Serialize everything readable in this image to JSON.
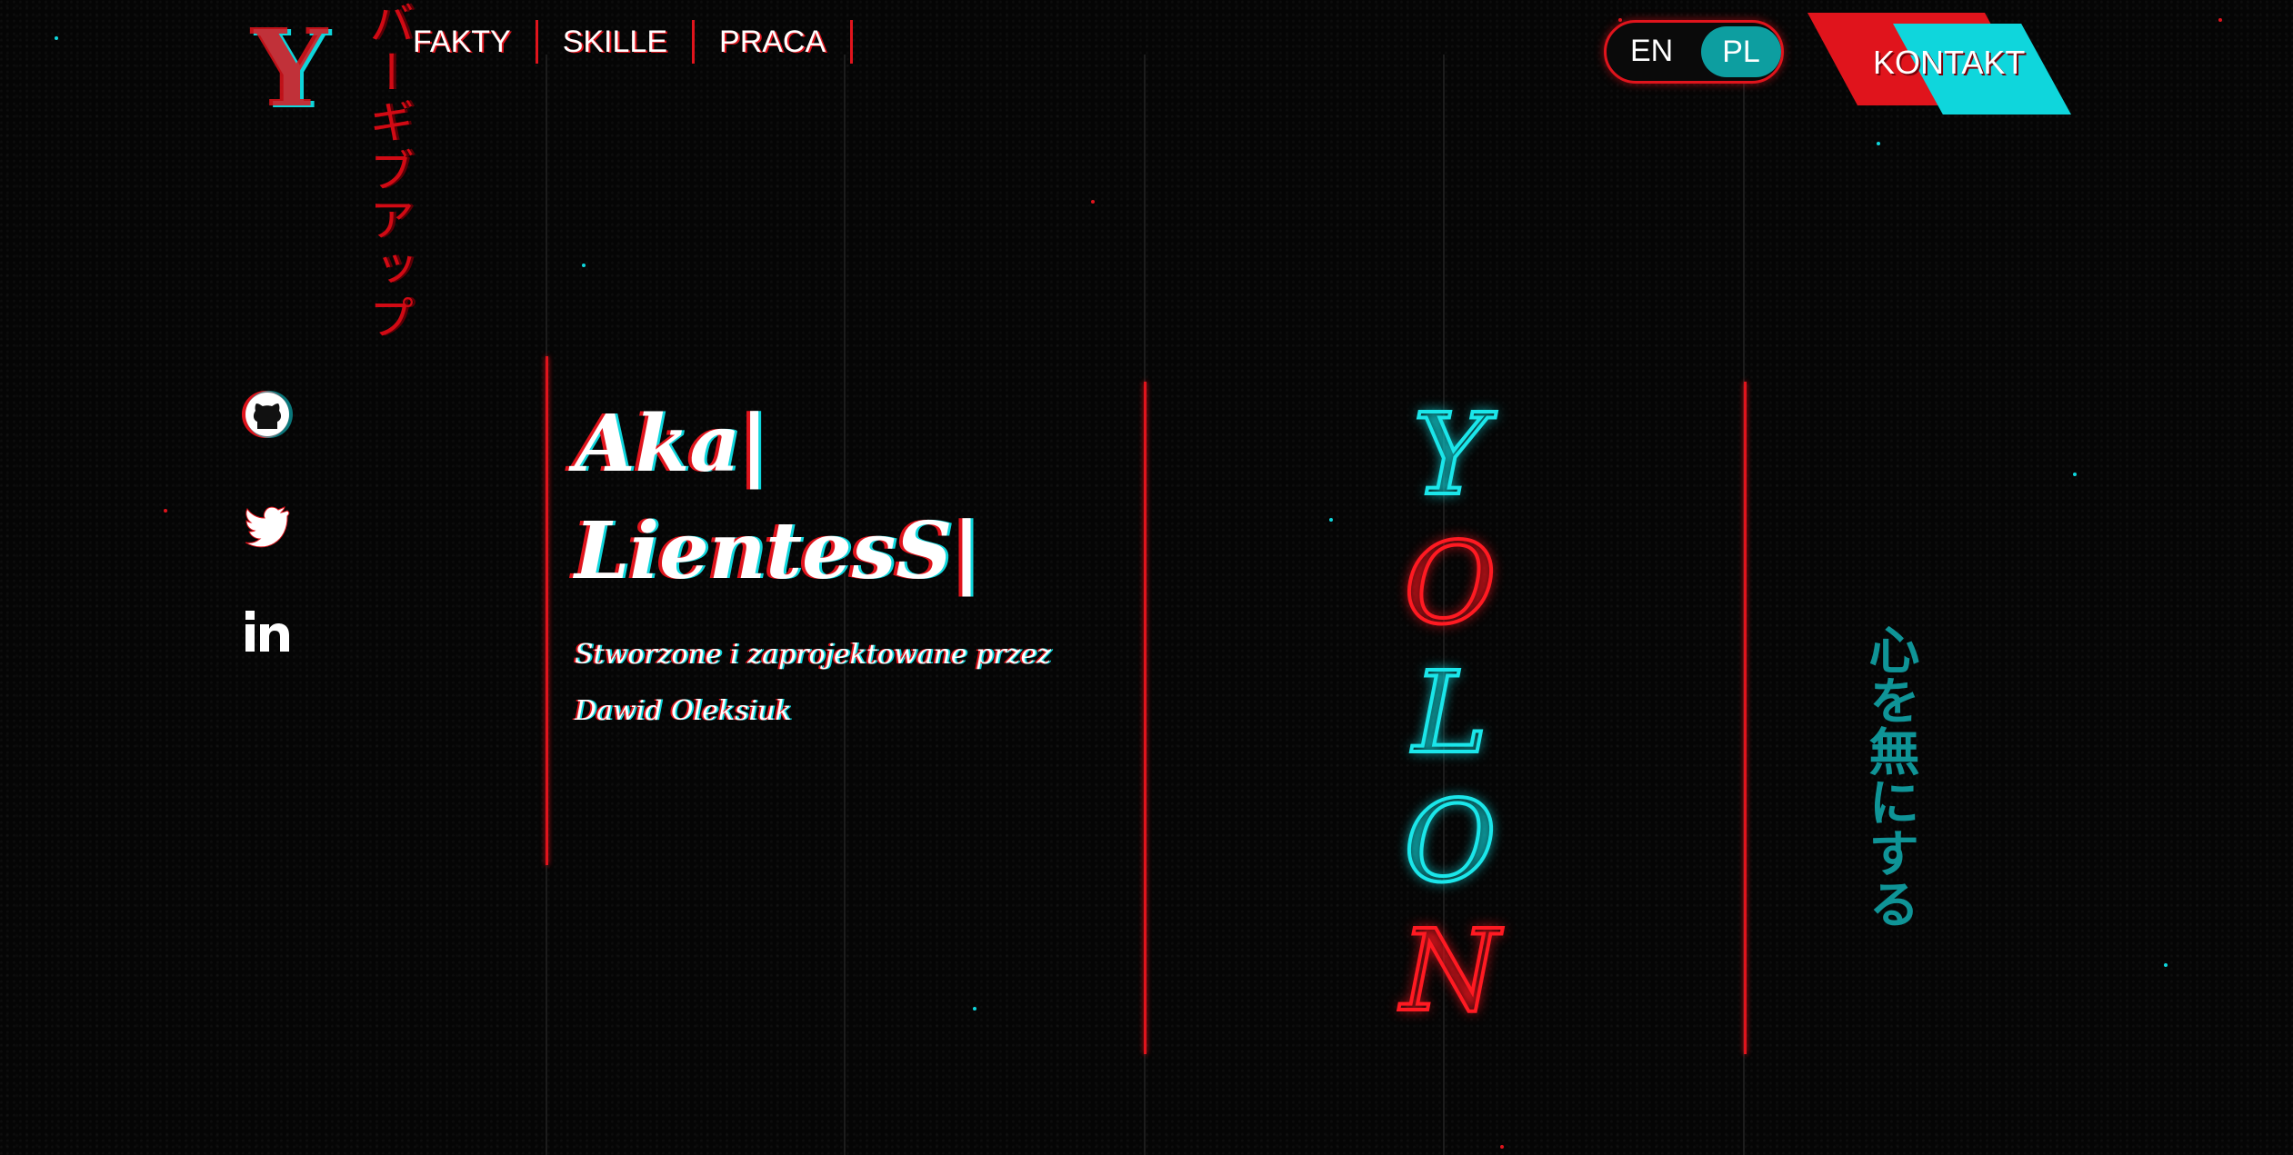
{
  "header": {
    "kana_vertical": "バーギブアップ",
    "nav": [
      "FAKTY",
      "SKILLE",
      "PRACA"
    ],
    "lang": {
      "en": "EN",
      "pl": "PL",
      "active": "PL"
    },
    "contact_label": "KONTAKT"
  },
  "logo": {
    "letter": "Y"
  },
  "socials": [
    "github-icon",
    "twitter-icon",
    "linkedin-icon"
  ],
  "hero": {
    "title_line1": "Aka|",
    "title_line2": "LientesS|",
    "subtitle": "Stworzone i zaprojektowane przez Dawid Oleksiuk"
  },
  "neon_word": [
    "Y",
    "O",
    "L",
    "O",
    "N"
  ],
  "kanji_vertical": "心を無にする",
  "colors": {
    "accent_red": "#e0141c",
    "accent_cyan": "#0fd6dc",
    "teal": "#0f9497",
    "background": "#050505"
  }
}
